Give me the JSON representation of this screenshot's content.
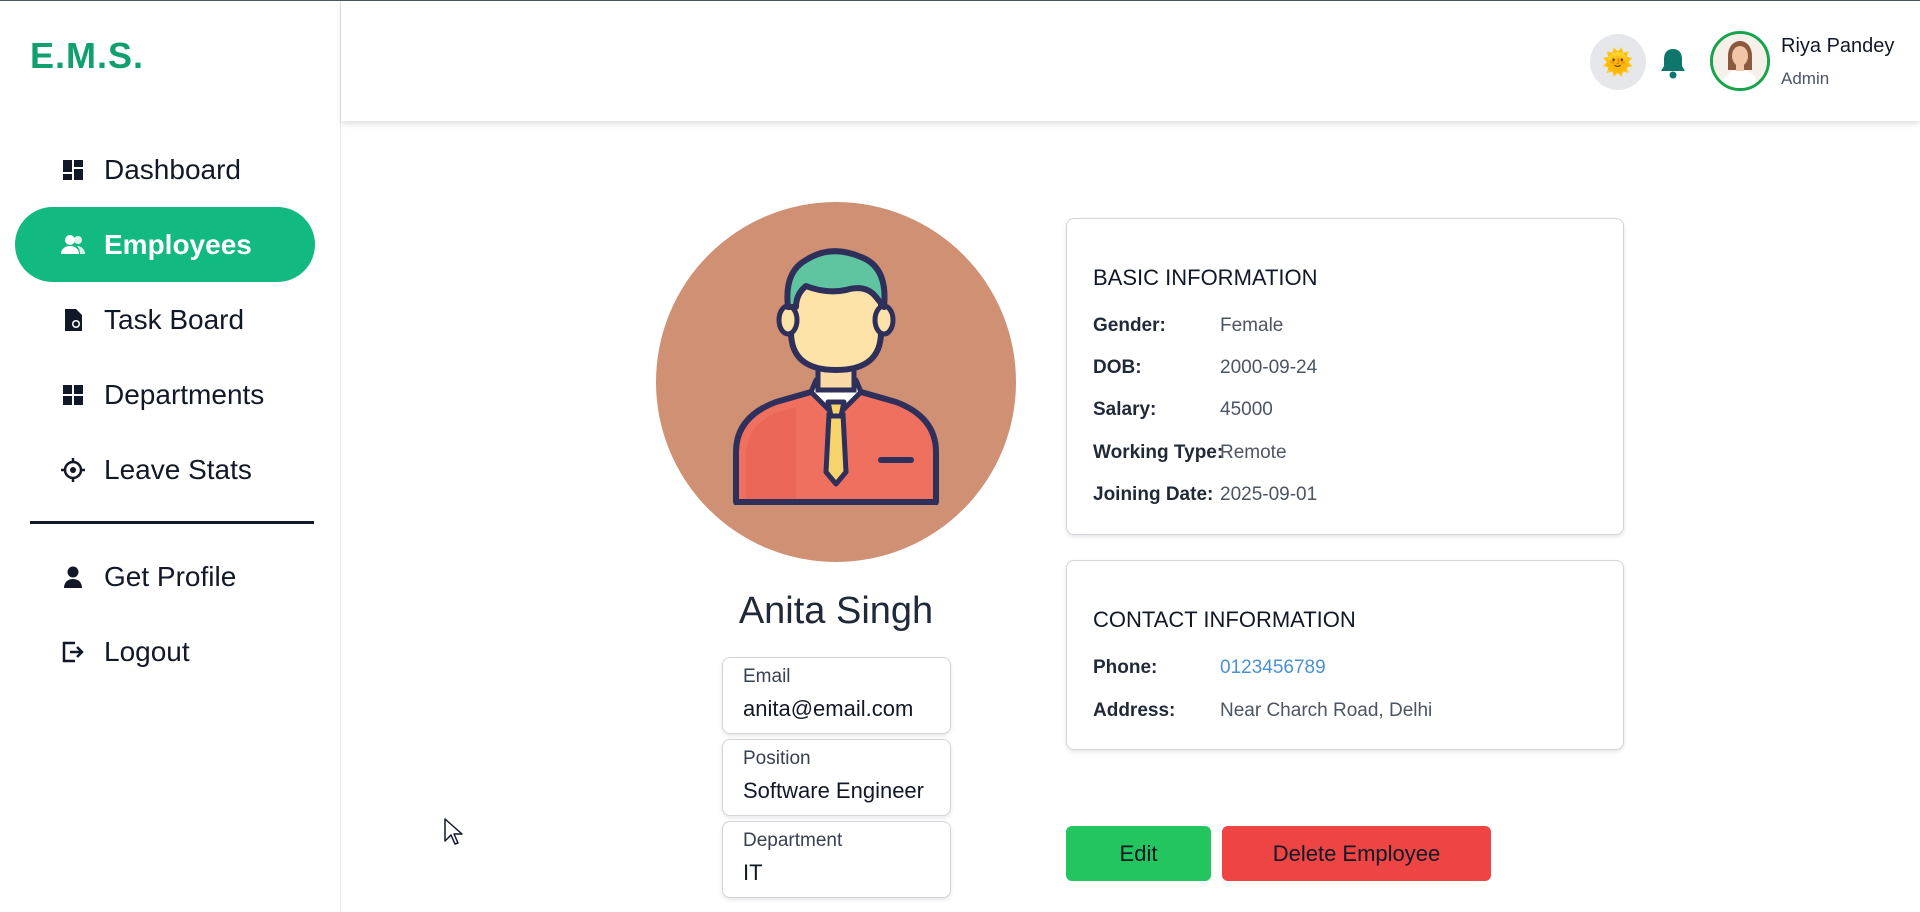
{
  "app": {
    "logo": "E.M.S."
  },
  "sidebar": {
    "items": [
      {
        "label": "Dashboard",
        "icon": "dashboard-icon",
        "active": false
      },
      {
        "label": "Employees",
        "icon": "users-icon",
        "active": true
      },
      {
        "label": "Task Board",
        "icon": "task-icon",
        "active": false
      },
      {
        "label": "Departments",
        "icon": "grid-icon",
        "active": false
      },
      {
        "label": "Leave Stats",
        "icon": "crosshair-icon",
        "active": false
      }
    ],
    "bottom_items": [
      {
        "label": "Get Profile",
        "icon": "person-icon"
      },
      {
        "label": "Logout",
        "icon": "logout-icon"
      }
    ]
  },
  "header": {
    "theme_icon": "sun-icon",
    "notification_icon": "bell-icon",
    "user": {
      "name": "Riya Pandey",
      "role": "Admin"
    }
  },
  "employee": {
    "name": "Anita Singh",
    "email_label": "Email",
    "email": "anita@email.com",
    "position_label": "Position",
    "position": "Software Engineer",
    "department_label": "Department",
    "department": "IT"
  },
  "basic_info": {
    "title": "BASIC INFORMATION",
    "rows": [
      {
        "key": "Gender:",
        "value": "Female"
      },
      {
        "key": "DOB:",
        "value": "2000-09-24"
      },
      {
        "key": "Salary:",
        "value": "45000"
      },
      {
        "key": "Working Type:",
        "value": "Remote"
      },
      {
        "key": "Joining Date:",
        "value": "2025-09-01"
      }
    ]
  },
  "contact_info": {
    "title": "CONTACT INFORMATION",
    "rows": [
      {
        "key": "Phone:",
        "value": "0123456789"
      },
      {
        "key": "Address:",
        "value": "Near Charch Road, Delhi"
      }
    ]
  },
  "actions": {
    "edit_label": "Edit",
    "delete_label": "Delete Employee"
  },
  "colors": {
    "brand": "#10a06e",
    "active_nav": "#12b981",
    "edit_button": "#22c55e",
    "delete_button": "#ef4444",
    "avatar_bg": "#cf9074",
    "phone_link": "#4a90d9"
  }
}
